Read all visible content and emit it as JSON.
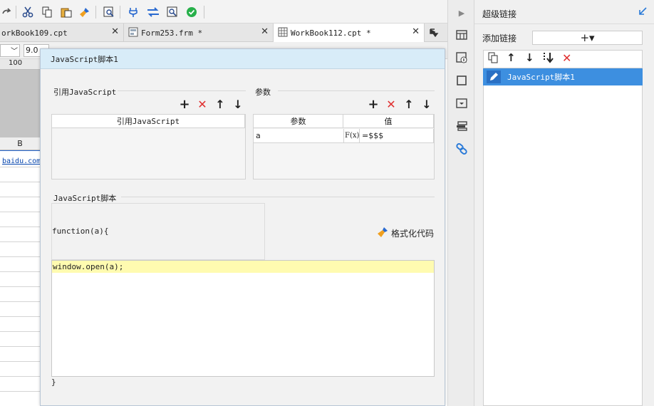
{
  "tabs": [
    {
      "label": "orkBook109.cpt",
      "active": false
    },
    {
      "label": "Form253.frm *",
      "active": false
    },
    {
      "label": "WorkBook112.cpt *",
      "active": true
    }
  ],
  "formatbar": {
    "font_size": "9.0"
  },
  "sheet": {
    "ruler_value": "100",
    "column_header": "B",
    "cell_link": "baidu.com"
  },
  "dialog": {
    "title": "JavaScript脚本1",
    "ref_section_label": "引用JavaScript",
    "ref_table_header": "引用JavaScript",
    "param_section_label": "参数",
    "param_headers": [
      "参数",
      "值"
    ],
    "param_rows": [
      {
        "name": "a",
        "fx": "F(x)",
        "value": "=$$$"
      }
    ],
    "script_section_label": "JavaScript脚本",
    "function_signature": "function(a){",
    "format_code_label": "格式化代码",
    "code_line": "window.open(a);",
    "closing_brace": "}"
  },
  "hyperlink_panel": {
    "title": "超级链接",
    "add_link_label": "添加链接",
    "add_button_label": "+▾",
    "items": [
      {
        "label": "JavaScript脚本1",
        "selected": true
      }
    ]
  },
  "colors": {
    "dialog_title_bg": "#d8ecf8",
    "selected_row_bg": "#3d8fe0",
    "code_highlight_bg": "#fffbb0",
    "delete_red": "#e03030",
    "link_blue": "#0645ad"
  }
}
